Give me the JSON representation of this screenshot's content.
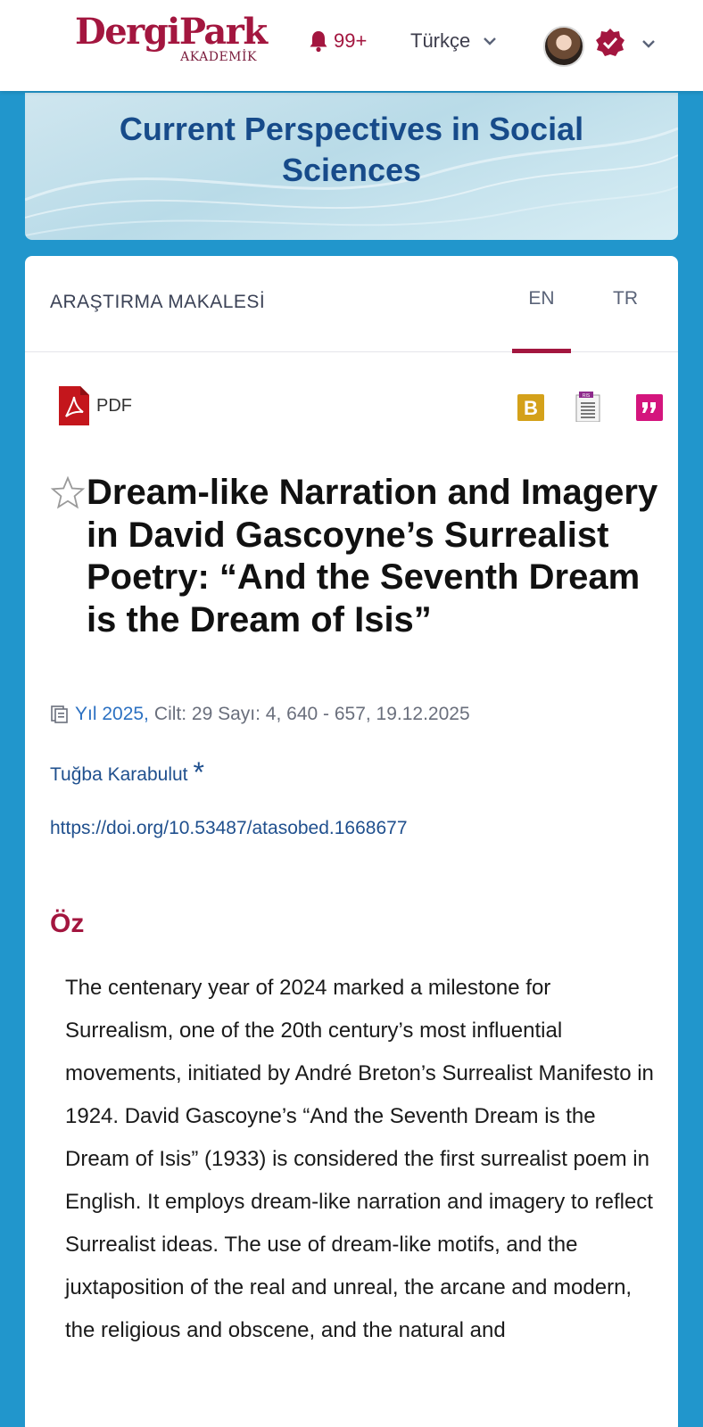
{
  "header": {
    "logo": {
      "main": "DergiPark",
      "sub": "AKADEMİK"
    },
    "notifications": {
      "count": "99+",
      "icon": "bell-icon"
    },
    "language": {
      "current": "Türkçe"
    },
    "colors": {
      "brand": "#a3163f",
      "accent": "#2196cc"
    }
  },
  "journal": {
    "title": "Current Perspectives in Social Sciences"
  },
  "article": {
    "type": "ARAŞTIRMA MAKALESİ",
    "tabs": [
      {
        "label": "EN",
        "active": true
      },
      {
        "label": "TR",
        "active": false
      }
    ],
    "pdf_label": "PDF",
    "citation_icons": [
      "bibtex-icon",
      "ris-icon",
      "cite-icon"
    ],
    "title": "Dream-like Narration and Imagery in David Gascoyne’s Surrealist Poetry: “And the Seventh Dream is the Dream of Isis”",
    "meta": {
      "year": "Yıl 2025,",
      "rest": "Cilt: 29 Sayı: 4, 640 - 657, 19.12.2025"
    },
    "author": {
      "name": "Tuğba Karabulut",
      "marker": "*"
    },
    "doi": "https://doi.org/10.53487/atasobed.1668677",
    "abstract_heading": "Öz",
    "abstract": "The centenary year of 2024 marked a milestone for Surrealism, one of the 20th century’s most influential movements, initiated by André Breton’s Surrealist Manifesto in 1924. David Gascoyne’s “And the Seventh Dream is the Dream of Isis” (1933) is considered the first surrealist poem in English. It employs dream-like narration and imagery to reflect Surrealist ideas. The use of dream-like motifs, and the juxtaposition of the real and unreal, the arcane and modern, the religious and obscene, and the natural and"
  }
}
